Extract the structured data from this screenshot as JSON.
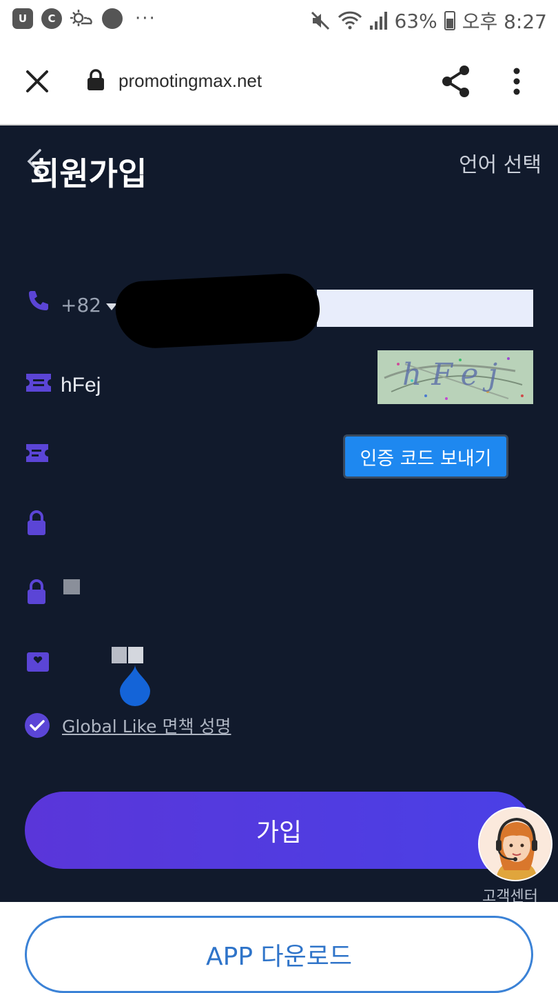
{
  "status_bar": {
    "app_icon_1": "U",
    "app_icon_2": "C",
    "more": "···",
    "battery_percent": "63%",
    "time": "오후 8:27"
  },
  "browser": {
    "url": "promotingmax.net",
    "icons": [
      "close-icon",
      "lock-icon",
      "share-icon",
      "more-vert-icon"
    ]
  },
  "page": {
    "title": "회원가입",
    "language_select": "언어 선택",
    "phone": {
      "country_code": "+82"
    },
    "captcha": {
      "value": "hFej",
      "image_text": "hFej"
    },
    "send_code_button": "인증 코드 보내기",
    "disclaimer_link": "Global Like 면책 성명",
    "signup_button": "가입",
    "support_label": "고객센터"
  },
  "footer": {
    "app_download_button": "APP 다운로드"
  },
  "colors": {
    "page_bg": "#111a2c",
    "accent_purple": "#5a36d9",
    "icon_purple": "#5b45d6",
    "send_button_blue": "#1e88f0",
    "download_blue": "#3b82d6"
  }
}
